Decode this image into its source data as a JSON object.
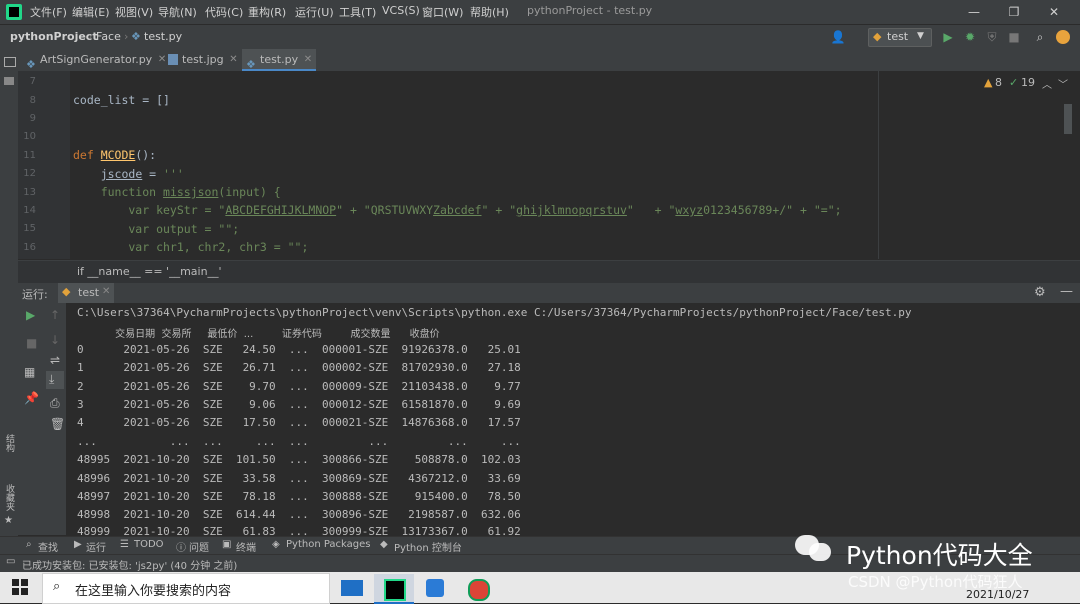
{
  "menubar": {
    "items": [
      "文件(F)",
      "编辑(E)",
      "视图(V)",
      "导航(N)",
      "代码(C)",
      "重构(R)",
      "运行(U)",
      "工具(T)",
      "VCS(S)",
      "窗口(W)",
      "帮助(H)"
    ],
    "window_title": "pythonProject - test.py",
    "minimize": "—",
    "restore": "❐",
    "close": "✕"
  },
  "navbar": {
    "project": "pythonProject",
    "folder": "Face",
    "file": "test.py",
    "run_config": "test"
  },
  "tabs": [
    {
      "label": "ArtSignGenerator.py"
    },
    {
      "label": "test.jpg"
    },
    {
      "label": "test.py"
    }
  ],
  "editor": {
    "inspections": {
      "warnings": "8",
      "ok": "19"
    },
    "line_numbers": [
      "7",
      "8",
      "9",
      "10",
      "11",
      "12",
      "13",
      "14",
      "15",
      "16"
    ],
    "hint": "if __name__ == '__main__'"
  },
  "run": {
    "label": "运行:",
    "tab": "test",
    "command": "C:\\Users\\37364\\PycharmProjects\\pythonProject\\venv\\Scripts\\python.exe C:/Users/37364/PycharmProjects/pythonProject/Face/test.py",
    "header_row": "            交易日期  交易所     最低价  ...         证券代码         成交数量      收盘价",
    "rows": [
      "0      2021-05-26  SZE   24.50  ...  000001-SZE  91926378.0   25.01",
      "1      2021-05-26  SZE   26.71  ...  000002-SZE  81702930.0   27.18",
      "2      2021-05-26  SZE    9.70  ...  000009-SZE  21103438.0    9.77",
      "3      2021-05-26  SZE    9.06  ...  000012-SZE  61581870.0    9.69",
      "4      2021-05-26  SZE   17.50  ...  000021-SZE  14876368.0   17.57",
      "...           ...  ...     ...  ...         ...         ...     ...",
      "48995  2021-10-20  SZE  101.50  ...  300866-SZE    508878.0  102.03",
      "48996  2021-10-20  SZE   33.58  ...  300869-SZE   4367212.0   33.69",
      "48997  2021-10-20  SZE   78.18  ...  300888-SZE    915400.0   78.50",
      "48998  2021-10-20  SZE  614.44  ...  300896-SZE   2198587.0  632.06",
      "48999  2021-10-20  SZE   61.83  ...  300999-SZE  13173367.0   61.92"
    ]
  },
  "left_strip": {
    "structure": "结构",
    "favorites": "收藏夹"
  },
  "tool_tabs": [
    {
      "label": "查找"
    },
    {
      "label": "运行"
    },
    {
      "label": "TODO"
    },
    {
      "label": "问题"
    },
    {
      "label": "终端"
    },
    {
      "label": "Python Packages"
    },
    {
      "label": "Python 控制台"
    }
  ],
  "status": "已成功安装包: 已安装包: 'js2py' (40 分钟 之前)",
  "taskbar": {
    "search_placeholder": "在这里输入你要搜索的内容",
    "date": "2021/10/27"
  },
  "watermark": {
    "brand": "Python代码大全",
    "source": "CSDN @Python代码狂人"
  },
  "colors": {
    "accent": "#4a88c7",
    "keyword": "#cc7832",
    "string": "#6a8759",
    "function": "#ffc66d"
  }
}
